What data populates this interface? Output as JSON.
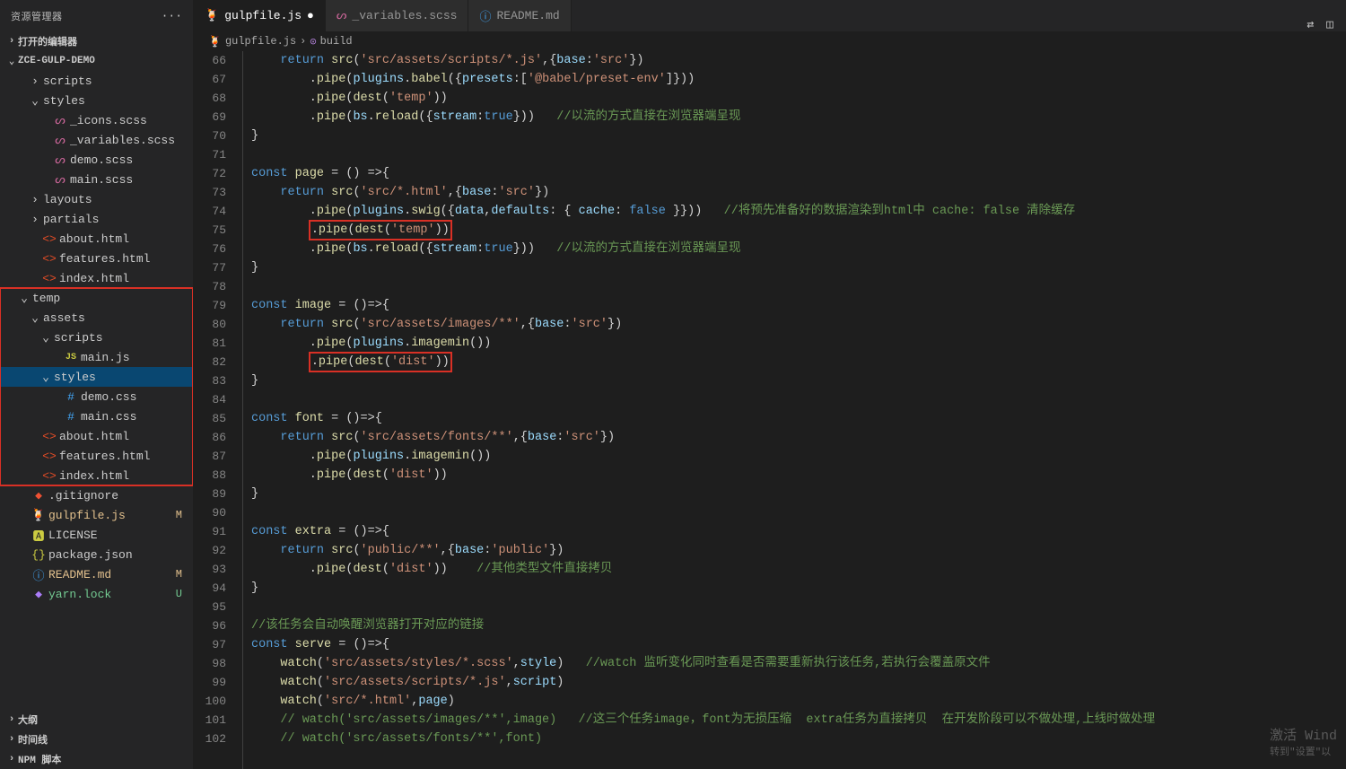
{
  "sidebar": {
    "title": "资源管理器",
    "sections": {
      "open_editors": "打开的编辑器",
      "project": "ZCE-GULP-DEMO",
      "outline": "大纲",
      "timeline": "时间线",
      "npm": "NPM 脚本"
    },
    "tree": [
      {
        "label": "scripts",
        "indent": 2,
        "chev": "›",
        "type": "folder"
      },
      {
        "label": "styles",
        "indent": 2,
        "chev": "⌄",
        "type": "folder"
      },
      {
        "label": "_icons.scss",
        "indent": 3,
        "icon": "scss"
      },
      {
        "label": "_variables.scss",
        "indent": 3,
        "icon": "scss"
      },
      {
        "label": "demo.scss",
        "indent": 3,
        "icon": "scss"
      },
      {
        "label": "main.scss",
        "indent": 3,
        "icon": "scss"
      },
      {
        "label": "layouts",
        "indent": 2,
        "chev": "›",
        "type": "folder"
      },
      {
        "label": "partials",
        "indent": 2,
        "chev": "›",
        "type": "folder"
      },
      {
        "label": "about.html",
        "indent": 2,
        "icon": "html"
      },
      {
        "label": "features.html",
        "indent": 2,
        "icon": "html"
      },
      {
        "label": "index.html",
        "indent": 2,
        "icon": "html"
      },
      {
        "label": "temp",
        "indent": 1,
        "chev": "⌄",
        "type": "folder",
        "red": true
      },
      {
        "label": "assets",
        "indent": 2,
        "chev": "⌄",
        "type": "folder",
        "red": true
      },
      {
        "label": "scripts",
        "indent": 3,
        "chev": "⌄",
        "type": "folder",
        "red": true
      },
      {
        "label": "main.js",
        "indent": 4,
        "icon": "js",
        "red": true
      },
      {
        "label": "styles",
        "indent": 3,
        "chev": "⌄",
        "type": "folder",
        "red": true,
        "selected": true
      },
      {
        "label": "demo.css",
        "indent": 4,
        "icon": "css",
        "red": true
      },
      {
        "label": "main.css",
        "indent": 4,
        "icon": "css",
        "red": true
      },
      {
        "label": "about.html",
        "indent": 2,
        "icon": "html",
        "red": true
      },
      {
        "label": "features.html",
        "indent": 2,
        "icon": "html",
        "red": true
      },
      {
        "label": "index.html",
        "indent": 2,
        "icon": "html",
        "red": true
      },
      {
        "label": ".gitignore",
        "indent": 1,
        "icon": "git"
      },
      {
        "label": "gulpfile.js",
        "indent": 1,
        "icon": "gulp",
        "badge": "M",
        "badgeCls": "m"
      },
      {
        "label": "LICENSE",
        "indent": 1,
        "icon": "lic"
      },
      {
        "label": "package.json",
        "indent": 1,
        "icon": "json"
      },
      {
        "label": "README.md",
        "indent": 1,
        "icon": "md",
        "badge": "M",
        "badgeCls": "m"
      },
      {
        "label": "yarn.lock",
        "indent": 1,
        "icon": "lock",
        "badge": "U",
        "badgeCls": "u"
      }
    ]
  },
  "tabs": [
    {
      "label": "gulpfile.js",
      "icon": "gulp",
      "active": true,
      "dirty": true
    },
    {
      "label": "_variables.scss",
      "icon": "scss",
      "active": false
    },
    {
      "label": "README.md",
      "icon": "md",
      "active": false
    }
  ],
  "breadcrumb": {
    "file": "gulpfile.js",
    "symbol": "build"
  },
  "lines": [
    {
      "n": 66,
      "html": "    <span class='kw'>return</span> <span class='fn'>src</span>(<span class='str'>'src/assets/scripts/*.js'</span>,{<span class='prop'>base</span>:<span class='str'>'src'</span>})"
    },
    {
      "n": 67,
      "html": "        .<span class='fn'>pipe</span>(<span class='var'>plugins</span>.<span class='fn'>babel</span>({<span class='prop'>presets</span>:[<span class='str'>'@babel/preset-env'</span>]}))"
    },
    {
      "n": 68,
      "html": "        .<span class='fn'>pipe</span>(<span class='fn'>dest</span>(<span class='str'>'temp'</span>))"
    },
    {
      "n": 69,
      "html": "        .<span class='fn'>pipe</span>(<span class='var'>bs</span>.<span class='fn'>reload</span>({<span class='prop'>stream</span>:<span class='bool'>true</span>}))   <span class='cmt'>//以流的方式直接在浏览器端呈现</span>"
    },
    {
      "n": 70,
      "html": "}"
    },
    {
      "n": 71,
      "html": ""
    },
    {
      "n": 72,
      "html": "<span class='kw'>const</span> <span class='fn'>page</span> = () =&gt;{"
    },
    {
      "n": 73,
      "html": "    <span class='kw'>return</span> <span class='fn'>src</span>(<span class='str'>'src/*.html'</span>,{<span class='prop'>base</span>:<span class='str'>'src'</span>})"
    },
    {
      "n": 74,
      "html": "        .<span class='fn'>pipe</span>(<span class='var'>plugins</span>.<span class='fn'>swig</span>({<span class='var'>data</span>,<span class='prop'>defaults</span>: { <span class='prop'>cache</span>: <span class='bool'>false</span> }}))   <span class='cmt'>//将预先准备好的数据渲染到html中 cache: false 清除缓存</span>"
    },
    {
      "n": 75,
      "html": "        <span class='redcode'>.<span class='fn'>pipe</span>(<span class='fn'>dest</span>(<span class='str'>'temp'</span>))</span>"
    },
    {
      "n": 76,
      "html": "        .<span class='fn'>pipe</span>(<span class='var'>bs</span>.<span class='fn'>reload</span>({<span class='prop'>stream</span>:<span class='bool'>true</span>}))   <span class='cmt'>//以流的方式直接在浏览器端呈现</span>"
    },
    {
      "n": 77,
      "html": "}"
    },
    {
      "n": 78,
      "html": ""
    },
    {
      "n": 79,
      "html": "<span class='kw'>const</span> <span class='fn'>image</span> = ()=&gt;{"
    },
    {
      "n": 80,
      "html": "    <span class='kw'>return</span> <span class='fn'>src</span>(<span class='str'>'src/assets/images/**'</span>,{<span class='prop'>base</span>:<span class='str'>'src'</span>})"
    },
    {
      "n": 81,
      "html": "        .<span class='fn'>pipe</span>(<span class='var'>plugins</span>.<span class='fn'>imagemin</span>())"
    },
    {
      "n": 82,
      "html": "        <span class='redcode'>.<span class='fn'>pipe</span>(<span class='fn'>dest</span>(<span class='str'>'dist'</span>))</span>"
    },
    {
      "n": 83,
      "html": "}"
    },
    {
      "n": 84,
      "html": ""
    },
    {
      "n": 85,
      "html": "<span class='kw'>const</span> <span class='fn'>font</span> = ()=&gt;{"
    },
    {
      "n": 86,
      "html": "    <span class='kw'>return</span> <span class='fn'>src</span>(<span class='str'>'src/assets/fonts/**'</span>,{<span class='prop'>base</span>:<span class='str'>'src'</span>})"
    },
    {
      "n": 87,
      "html": "        .<span class='fn'>pipe</span>(<span class='var'>plugins</span>.<span class='fn'>imagemin</span>())"
    },
    {
      "n": 88,
      "html": "        .<span class='fn'>pipe</span>(<span class='fn'>dest</span>(<span class='str'>'dist'</span>))"
    },
    {
      "n": 89,
      "html": "}"
    },
    {
      "n": 90,
      "html": ""
    },
    {
      "n": 91,
      "html": "<span class='kw'>const</span> <span class='fn'>extra</span> = ()=&gt;{"
    },
    {
      "n": 92,
      "html": "    <span class='kw'>return</span> <span class='fn'>src</span>(<span class='str'>'public/**'</span>,{<span class='prop'>base</span>:<span class='str'>'public'</span>})"
    },
    {
      "n": 93,
      "html": "        .<span class='fn'>pipe</span>(<span class='fn'>dest</span>(<span class='str'>'dist'</span>))    <span class='cmt'>//其他类型文件直接拷贝</span>"
    },
    {
      "n": 94,
      "html": "}"
    },
    {
      "n": 95,
      "html": ""
    },
    {
      "n": 96,
      "html": "<span class='cmt'>//该任务会自动唤醒浏览器打开对应的链接</span>"
    },
    {
      "n": 97,
      "html": "<span class='kw'>const</span> <span class='fn'>serve</span> = ()=&gt;{"
    },
    {
      "n": 98,
      "html": "    <span class='fn'>watch</span>(<span class='str'>'src/assets/styles/*.scss'</span>,<span class='var'>style</span>)   <span class='cmt'>//watch 监听变化同时查看是否需要重新执行该任务,若执行会覆盖原文件</span>"
    },
    {
      "n": 99,
      "html": "    <span class='fn'>watch</span>(<span class='str'>'src/assets/scripts/*.js'</span>,<span class='var'>script</span>)"
    },
    {
      "n": 100,
      "html": "    <span class='fn'>watch</span>(<span class='str'>'src/*.html'</span>,<span class='var'>page</span>)"
    },
    {
      "n": 101,
      "html": "    <span class='cmt'>// watch('src/assets/images/**',image)   //这三个任务image，font为无损压缩  extra任务为直接拷贝  在开发阶段可以不做处理,上线时做处理</span>"
    },
    {
      "n": 102,
      "html": "    <span class='cmt'>// watch('src/assets/fonts/**',font)</span>"
    }
  ],
  "watermark": {
    "line1": "激活 Wind",
    "line2": "转到\"设置\"以"
  }
}
